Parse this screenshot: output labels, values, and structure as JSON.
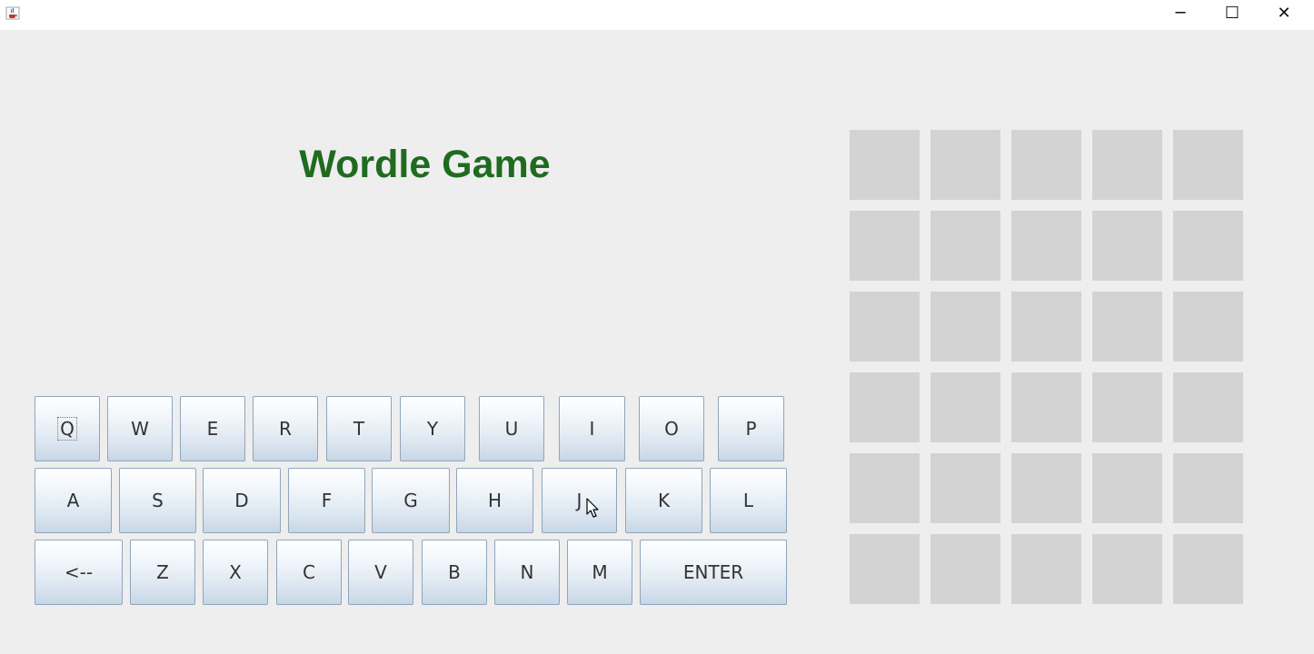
{
  "window": {
    "icon": "java-cup-icon",
    "minimize_glyph": "─",
    "maximize_glyph": "☐",
    "close_glyph": "✕"
  },
  "app": {
    "title": "Wordle Game",
    "title_color": "#1f6b1f"
  },
  "keyboard": {
    "row1": [
      "Q",
      "W",
      "E",
      "R",
      "T",
      "Y",
      "U",
      "I",
      "O",
      "P"
    ],
    "row2": [
      "A",
      "S",
      "D",
      "F",
      "G",
      "H",
      "J",
      "K",
      "L"
    ],
    "row3": [
      "<--",
      "Z",
      "X",
      "C",
      "V",
      "B",
      "N",
      "M",
      "ENTER"
    ],
    "focused_key": "Q"
  },
  "board": {
    "rows": 6,
    "cols": 5,
    "letters": [
      [
        "",
        "",
        "",
        "",
        ""
      ],
      [
        "",
        "",
        "",
        "",
        ""
      ],
      [
        "",
        "",
        "",
        "",
        ""
      ],
      [
        "",
        "",
        "",
        "",
        ""
      ],
      [
        "",
        "",
        "",
        "",
        ""
      ],
      [
        "",
        "",
        "",
        "",
        ""
      ]
    ],
    "cell_color": "#d3d3d3"
  }
}
